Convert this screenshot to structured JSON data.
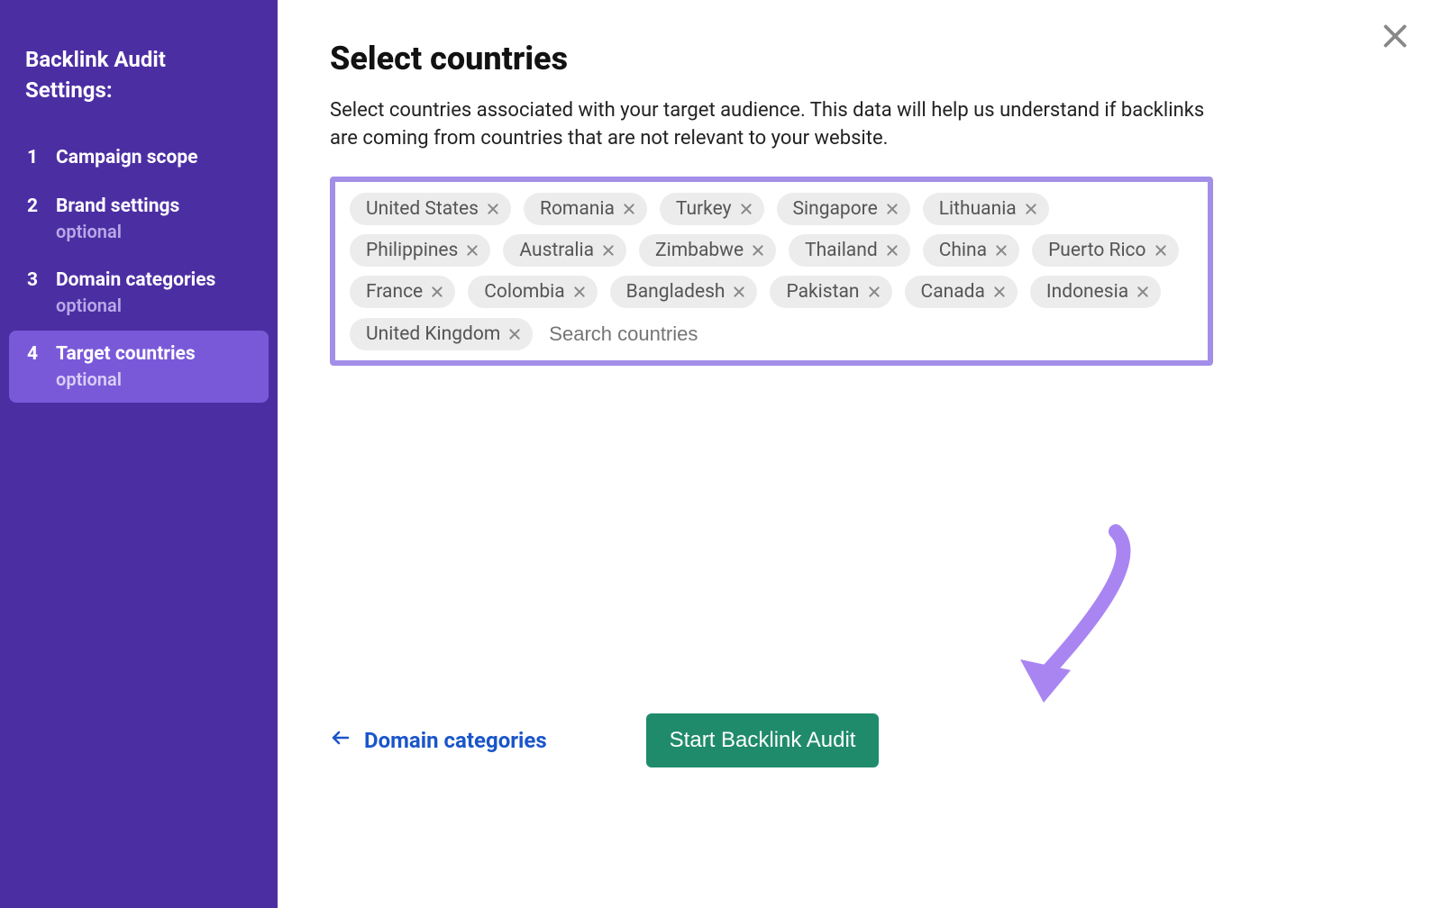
{
  "sidebar": {
    "title": "Backlink Audit Settings:",
    "steps": [
      {
        "num": "1",
        "label": "Campaign scope",
        "optional": ""
      },
      {
        "num": "2",
        "label": "Brand settings",
        "optional": "optional"
      },
      {
        "num": "3",
        "label": "Domain categories",
        "optional": "optional"
      },
      {
        "num": "4",
        "label": "Target countries",
        "optional": "optional"
      }
    ]
  },
  "main": {
    "title": "Select countries",
    "description": "Select countries associated with your target audience. This data will help us understand if backlinks are coming from countries that are not relevant to your website.",
    "search_placeholder": "Search countries",
    "countries": [
      "United States",
      "Romania",
      "Turkey",
      "Singapore",
      "Lithuania",
      "Philippines",
      "Australia",
      "Zimbabwe",
      "Thailand",
      "China",
      "Puerto Rico",
      "France",
      "Colombia",
      "Bangladesh",
      "Pakistan",
      "Canada",
      "Indonesia",
      "United Kingdom"
    ]
  },
  "footer": {
    "back_label": "Domain categories",
    "primary_label": "Start Backlink Audit"
  }
}
